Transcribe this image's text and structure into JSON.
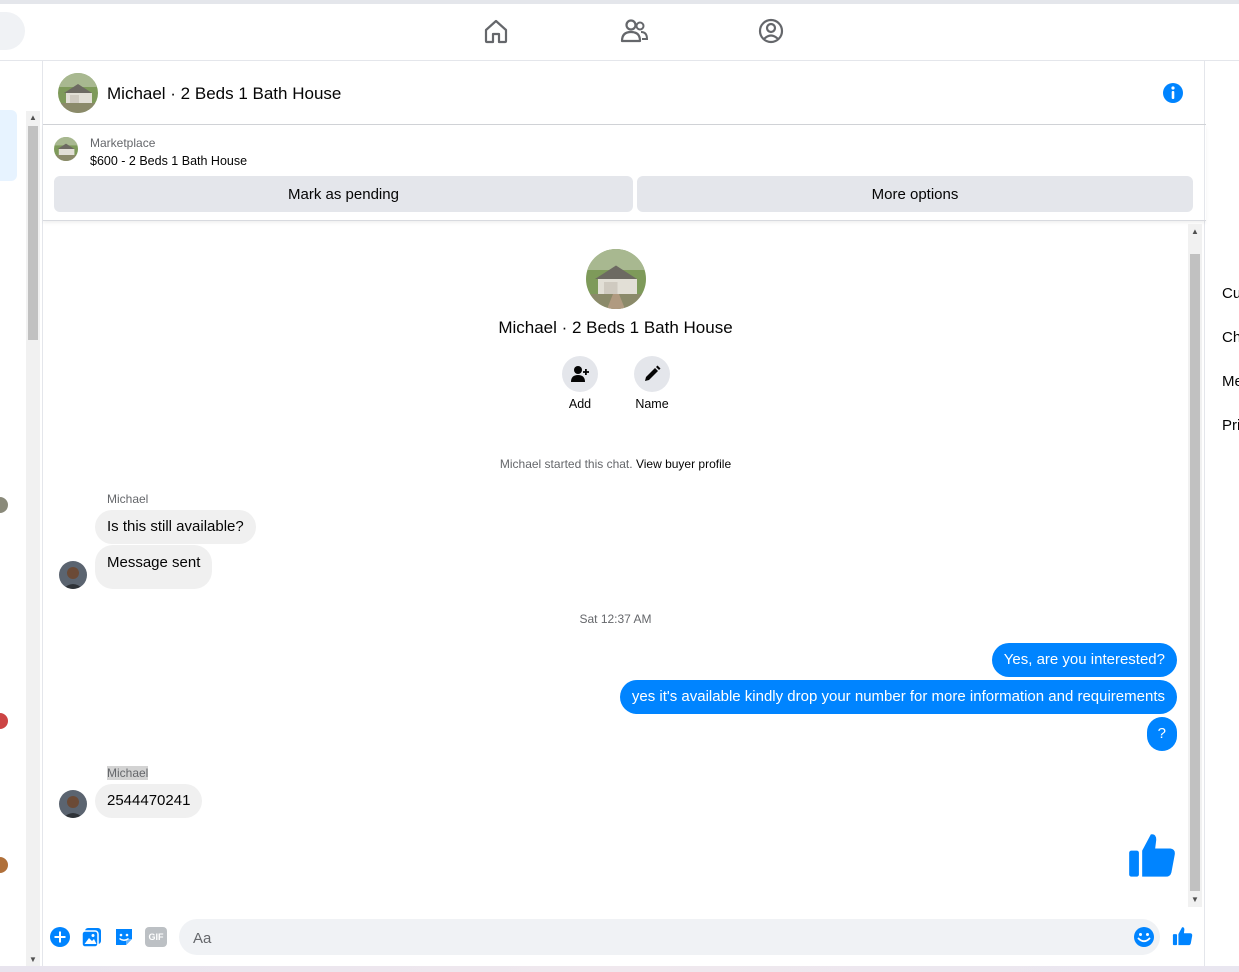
{
  "colors": {
    "brand": "#0084ff",
    "bubble_in": "#f0f0f0",
    "button_bg": "#e4e6eb"
  },
  "nav": {
    "icons": [
      "home-icon",
      "friends-icon",
      "profile-icon"
    ]
  },
  "chat": {
    "title": "Michael · 2 Beds 1 Bath House",
    "marketplace": {
      "label": "Marketplace",
      "description": "$600 - 2 Beds 1 Bath House",
      "mark_pending": "Mark as pending",
      "more_options": "More options"
    },
    "profile": {
      "name": "Michael · 2 Beds 1 Bath House",
      "add_label": "Add",
      "name_label": "Name",
      "started_text": "Michael started this chat.",
      "view_profile": "View buyer profile"
    },
    "messages": {
      "sender1": "Michael",
      "in1": "Is this still available?",
      "in2": "Message sent",
      "timestamp": "Sat 12:37 AM",
      "out1": "Yes, are you interested?",
      "out2": "yes it's available kindly drop your number for more information and requirements",
      "out3": "?",
      "sender2": "Michael",
      "in3": "2544470241"
    },
    "composer": {
      "placeholder": "Aa",
      "icons": [
        "plus-icon",
        "photo-icon",
        "sticker-icon",
        "gif-icon",
        "emoji-icon",
        "thumbs-up-icon"
      ],
      "gif_text": "GIF"
    }
  },
  "right_sidebar": {
    "items": [
      "Cu",
      "Ch",
      "Me",
      "Pri"
    ]
  }
}
